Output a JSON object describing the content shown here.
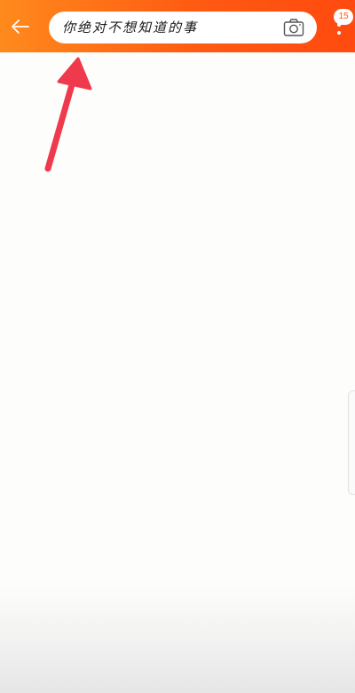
{
  "header": {
    "search_query": "你绝对不想知道的事",
    "notification_count": "15"
  },
  "icons": {
    "back": "back-arrow-icon",
    "camera": "camera-icon",
    "more": "more-vertical-icon"
  },
  "colors": {
    "header_start": "#ff8a1c",
    "header_end": "#ff4a10",
    "annotation_arrow": "#ee3a4c",
    "background": "#fdfdfc"
  }
}
